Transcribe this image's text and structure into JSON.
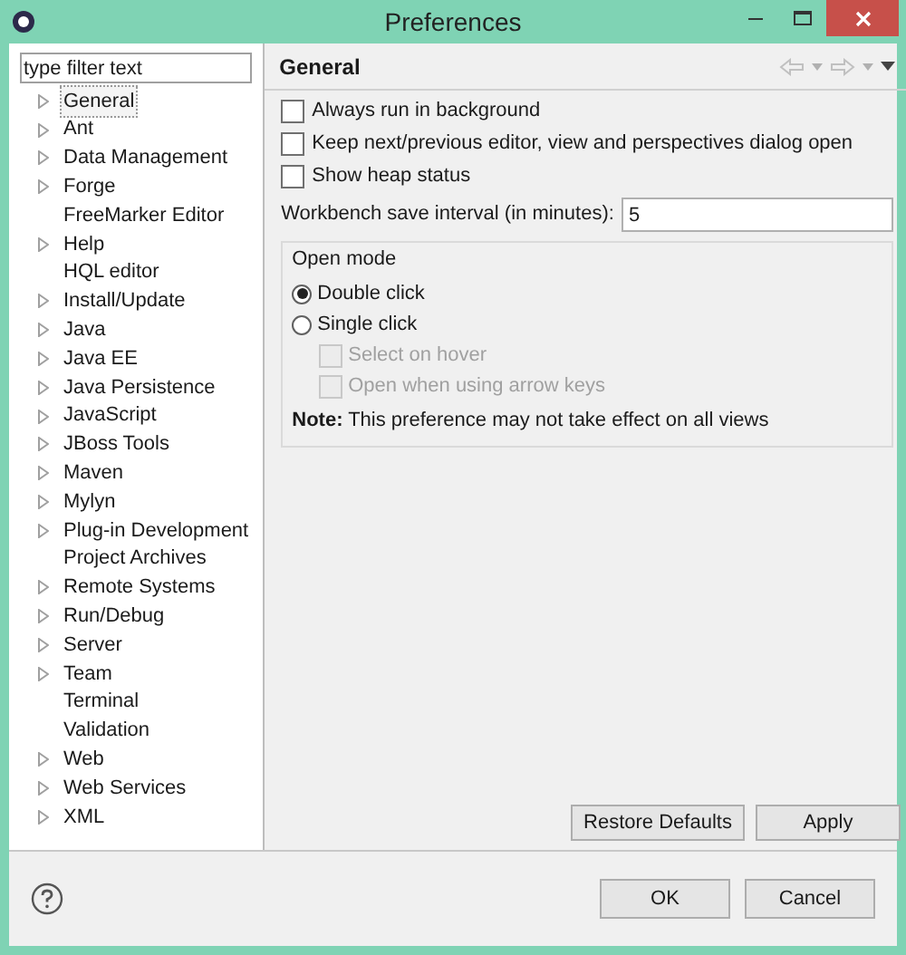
{
  "window": {
    "title": "Preferences"
  },
  "filter": {
    "value": "type filter text"
  },
  "tree": [
    {
      "label": "General",
      "expandable": true,
      "selected": true
    },
    {
      "label": "Ant",
      "expandable": true,
      "selected": false
    },
    {
      "label": "Data Management",
      "expandable": true,
      "selected": false
    },
    {
      "label": "Forge",
      "expandable": true,
      "selected": false
    },
    {
      "label": "FreeMarker Editor",
      "expandable": false,
      "selected": false
    },
    {
      "label": "Help",
      "expandable": true,
      "selected": false
    },
    {
      "label": "HQL editor",
      "expandable": false,
      "selected": false
    },
    {
      "label": "Install/Update",
      "expandable": true,
      "selected": false
    },
    {
      "label": "Java",
      "expandable": true,
      "selected": false
    },
    {
      "label": "Java EE",
      "expandable": true,
      "selected": false
    },
    {
      "label": "Java Persistence",
      "expandable": true,
      "selected": false
    },
    {
      "label": "JavaScript",
      "expandable": true,
      "selected": false
    },
    {
      "label": "JBoss Tools",
      "expandable": true,
      "selected": false
    },
    {
      "label": "Maven",
      "expandable": true,
      "selected": false
    },
    {
      "label": "Mylyn",
      "expandable": true,
      "selected": false
    },
    {
      "label": "Plug-in Development",
      "expandable": true,
      "selected": false
    },
    {
      "label": "Project Archives",
      "expandable": false,
      "selected": false
    },
    {
      "label": "Remote Systems",
      "expandable": true,
      "selected": false
    },
    {
      "label": "Run/Debug",
      "expandable": true,
      "selected": false
    },
    {
      "label": "Server",
      "expandable": true,
      "selected": false
    },
    {
      "label": "Team",
      "expandable": true,
      "selected": false
    },
    {
      "label": "Terminal",
      "expandable": false,
      "selected": false
    },
    {
      "label": "Validation",
      "expandable": false,
      "selected": false
    },
    {
      "label": "Web",
      "expandable": true,
      "selected": false
    },
    {
      "label": "Web Services",
      "expandable": true,
      "selected": false
    },
    {
      "label": "XML",
      "expandable": true,
      "selected": false
    }
  ],
  "page": {
    "title": "General",
    "checkboxes": [
      {
        "label": "Always run in background",
        "checked": false
      },
      {
        "label": "Keep next/previous editor, view and perspectives dialog open",
        "checked": false
      },
      {
        "label": "Show heap status",
        "checked": false
      }
    ],
    "interval": {
      "label": "Workbench save interval (in minutes):",
      "value": "5"
    },
    "open_mode": {
      "title": "Open mode",
      "options": [
        {
          "label": "Double click",
          "selected": true
        },
        {
          "label": "Single click",
          "selected": false
        }
      ],
      "sub_options": [
        {
          "label": "Select on hover",
          "checked": false,
          "disabled": true
        },
        {
          "label": "Open when using arrow keys",
          "checked": false,
          "disabled": true
        }
      ],
      "note": "**Note:** This preference may not take effect on all views"
    },
    "buttons": [
      "Restore Defaults",
      "Apply"
    ]
  },
  "footer_buttons": [
    "OK",
    "Cancel"
  ]
}
